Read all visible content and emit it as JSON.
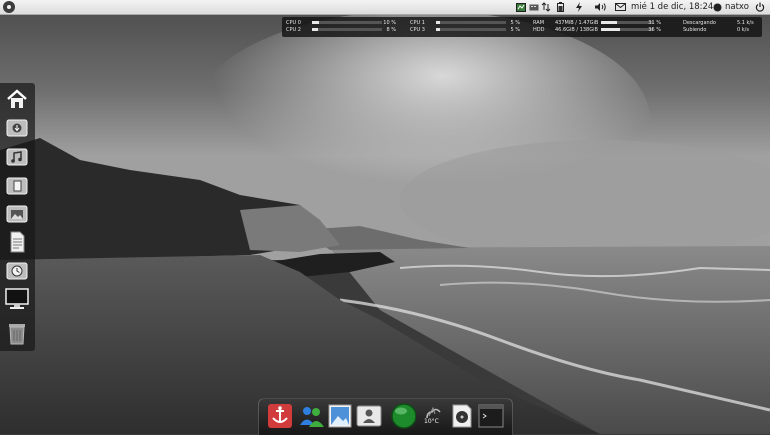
{
  "top_panel": {
    "clock": "mié 1 de dic, 18:24",
    "username": "natxo"
  },
  "system_monitor": {
    "cpu": [
      {
        "label": "CPU 0",
        "value": "10 %",
        "fraction": 0.1
      },
      {
        "label": "CPU 1",
        "value": "5 %",
        "fraction": 0.05
      },
      {
        "label": "CPU 2",
        "value": "8 %",
        "fraction": 0.08
      },
      {
        "label": "CPU 3",
        "value": "5 %",
        "fraction": 0.05
      }
    ],
    "memory": [
      {
        "label": "RAM",
        "value": "437MiB / 1.47GiB",
        "percent": "31 %",
        "fraction": 0.31
      },
      {
        "label": "HDD",
        "value": "46.6GiB / 138GiB",
        "percent": "36 %",
        "fraction": 0.36
      }
    ],
    "network": [
      {
        "label": "Descargando",
        "value": "5.1 k/s"
      },
      {
        "label": "Subiendo",
        "value": "0 k/s"
      }
    ]
  },
  "launcher": {
    "items": [
      "home-icon",
      "download-folder-icon",
      "music-folder-icon",
      "documents-folder-icon",
      "pictures-folder-icon",
      "text-file-icon",
      "clock-folder-icon",
      "monitor-icon",
      "trash-icon"
    ]
  },
  "dock": {
    "items": [
      "anchor-app-icon",
      "contacts-app-icon",
      "image-viewer-icon",
      "address-book-icon",
      "green-orb-icon",
      "weather-icon",
      "disk-utility-icon",
      "terminal-icon"
    ],
    "weather_temp": "10°C"
  }
}
